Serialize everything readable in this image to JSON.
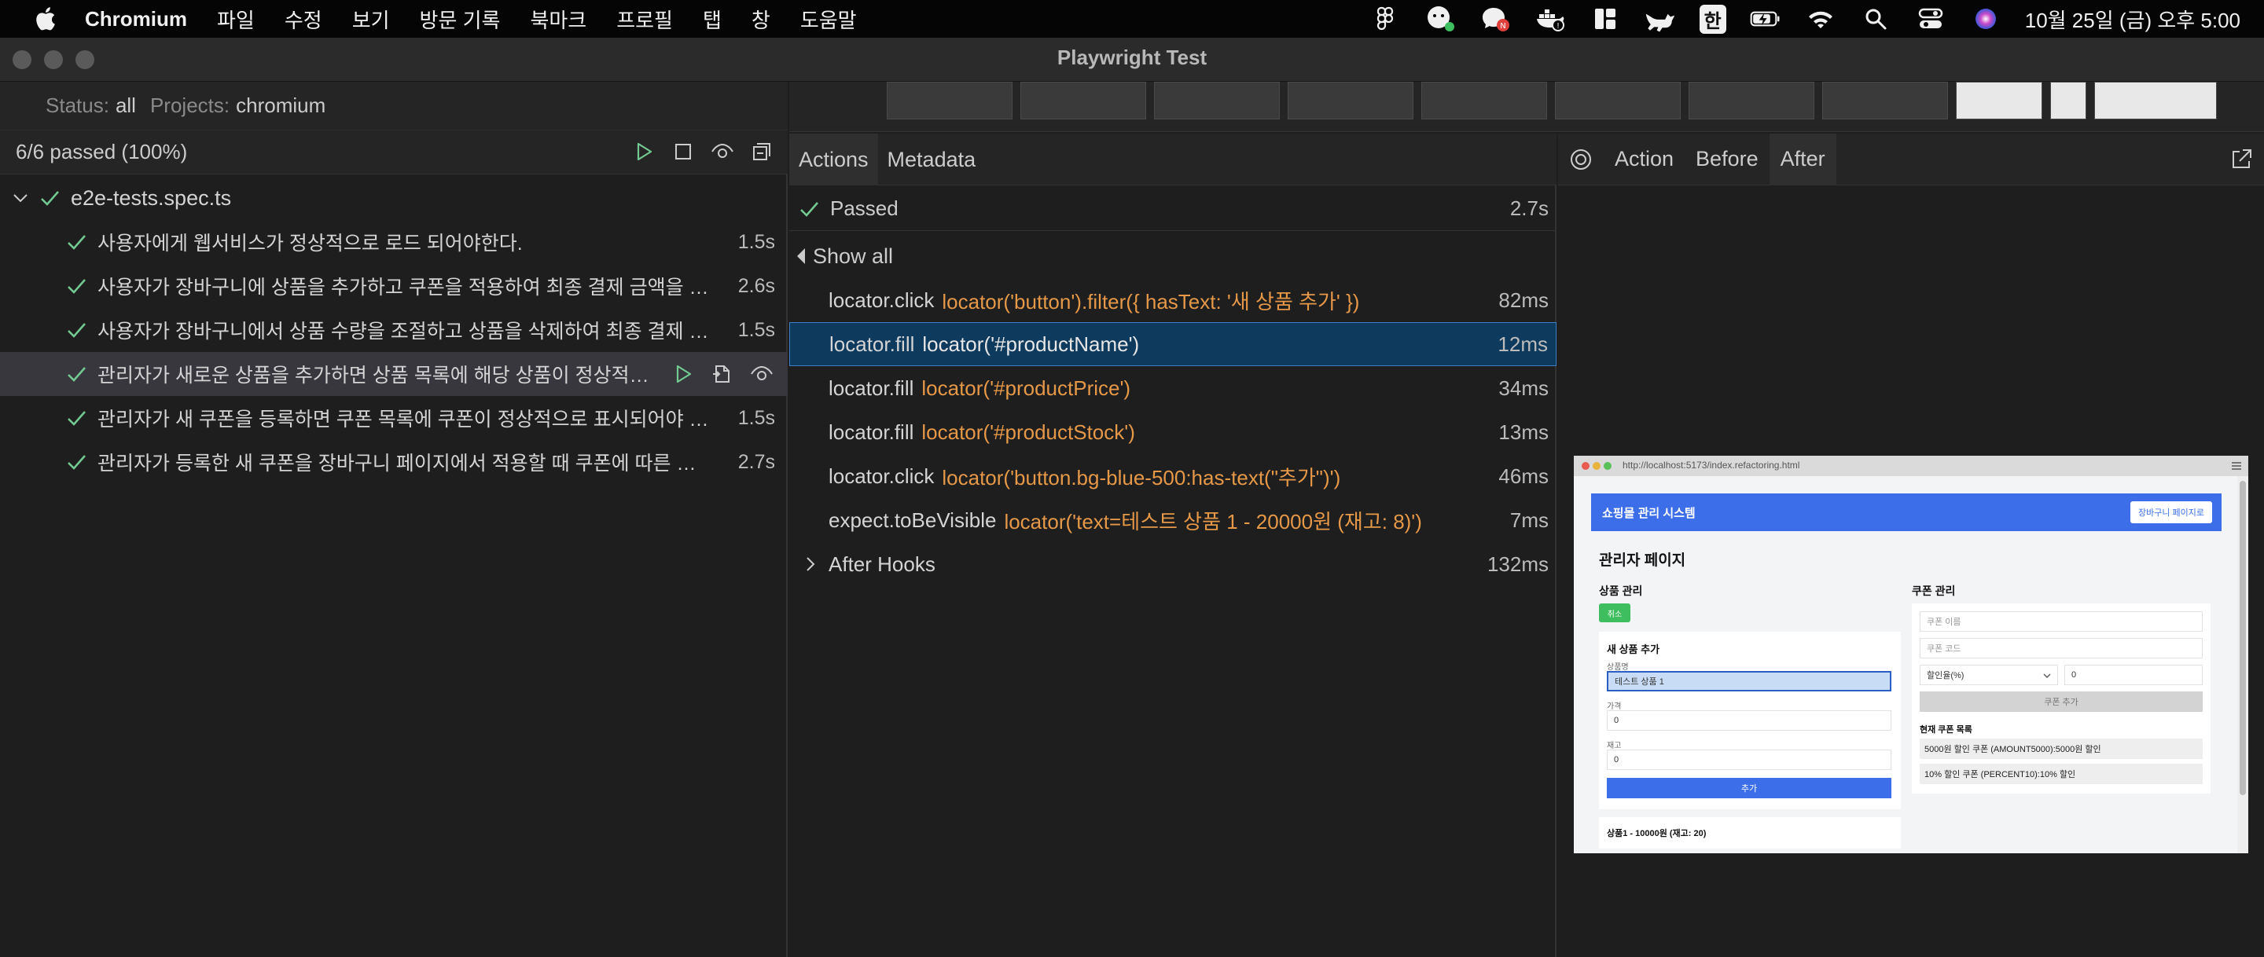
{
  "menubar": {
    "app_name": "Chromium",
    "menus": [
      "파일",
      "수정",
      "보기",
      "방문 기록",
      "북마크",
      "프로필",
      "탭",
      "창",
      "도움말"
    ],
    "input_source": "한",
    "clock": "10월 25일 (금) 오후 5:00"
  },
  "window": {
    "title": "Playwright Test"
  },
  "sidebar": {
    "status_key": "Status:",
    "status_value": "all",
    "projects_key": "Projects:",
    "projects_value": "chromium",
    "summary": "6/6 passed (100%)",
    "file_name": "e2e-tests.spec.ts",
    "tests": [
      {
        "name": "사용자에게 웹서비스가 정상적으로 로드 되어야한다.",
        "duration": "1.5s"
      },
      {
        "name": "사용자가 장바구니에 상품을 추가하고 쿠폰을 적용하여 최종 결제 금액을 확...",
        "duration": "2.6s"
      },
      {
        "name": "사용자가 장바구니에서 상품 수량을 조절하고 상품을 삭제하여 최종 결제 금액...",
        "duration": "1.5s"
      },
      {
        "name": "관리자가 새로운 상품을 추가하면 상품 목록에 해당 상품이 정상적으...",
        "duration": ""
      },
      {
        "name": "관리자가 새 쿠폰을 등록하면 쿠폰 목록에 쿠폰이 정상적으로 표시되어야 한다.",
        "duration": "1.5s"
      },
      {
        "name": "관리자가 등록한 새 쿠폰을 장바구니 페이지에서 적용할 때 쿠폰에 따른 할인...",
        "duration": "2.7s"
      }
    ]
  },
  "actions_panel": {
    "tabs": [
      "Actions",
      "Metadata"
    ],
    "passed_label": "Passed",
    "passed_duration": "2.7s",
    "show_all": "Show all",
    "actions": [
      {
        "method": "locator.click",
        "selector": "locator('button').filter({ hasText: '새 상품 추가' })",
        "duration": "82ms"
      },
      {
        "method": "locator.fill",
        "selector": "locator('#productName')",
        "duration": "12ms"
      },
      {
        "method": "locator.fill",
        "selector": "locator('#productPrice')",
        "duration": "34ms"
      },
      {
        "method": "locator.fill",
        "selector": "locator('#productStock')",
        "duration": "13ms"
      },
      {
        "method": "locator.click",
        "selector": "locator('button.bg-blue-500:has-text(\"추가\")')",
        "duration": "46ms"
      },
      {
        "method": "expect.toBeVisible",
        "selector": "locator('text=테스트 상품 1 - 20000원 (재고: 8)')",
        "duration": "7ms"
      }
    ],
    "after_hooks": "After Hooks",
    "after_hooks_duration": "132ms"
  },
  "snapshot_panel": {
    "tabs": [
      "Action",
      "Before",
      "After"
    ],
    "preview": {
      "url": "http://localhost:5173/index.refactoring.html",
      "app_title": "쇼핑몰 관리 시스템",
      "cart_button": "장바구니 페이지로",
      "page_title": "관리자 페이지",
      "product_section": "상품 관리",
      "cancel_button": "취소",
      "new_product_title": "새 상품 추가",
      "name_label": "상품명",
      "name_value": "테스트 상품 1",
      "price_label": "가격",
      "price_value": "0",
      "stock_label": "재고",
      "stock_value": "0",
      "add_button": "추가",
      "product_item": "상품1 - 10000원 (재고: 20)",
      "coupon_section": "쿠폰 관리",
      "coupon_name_ph": "쿠폰 이름",
      "coupon_code_ph": "쿠폰 코드",
      "discount_type": "할인율(%)",
      "discount_value": "0",
      "coupon_add_button": "쿠폰 추가",
      "coupon_list_title": "현재 쿠폰 목록",
      "coupons": [
        "5000원 할인 쿠폰 (AMOUNT5000):5000원 할인",
        "10% 할인 쿠폰 (PERCENT10):10% 할인"
      ]
    }
  },
  "colors": {
    "accent_orange": "#e59848",
    "check_green": "#73c991",
    "selected_blue": "#0e3a5e",
    "preview_blue": "#3b6ee8"
  }
}
